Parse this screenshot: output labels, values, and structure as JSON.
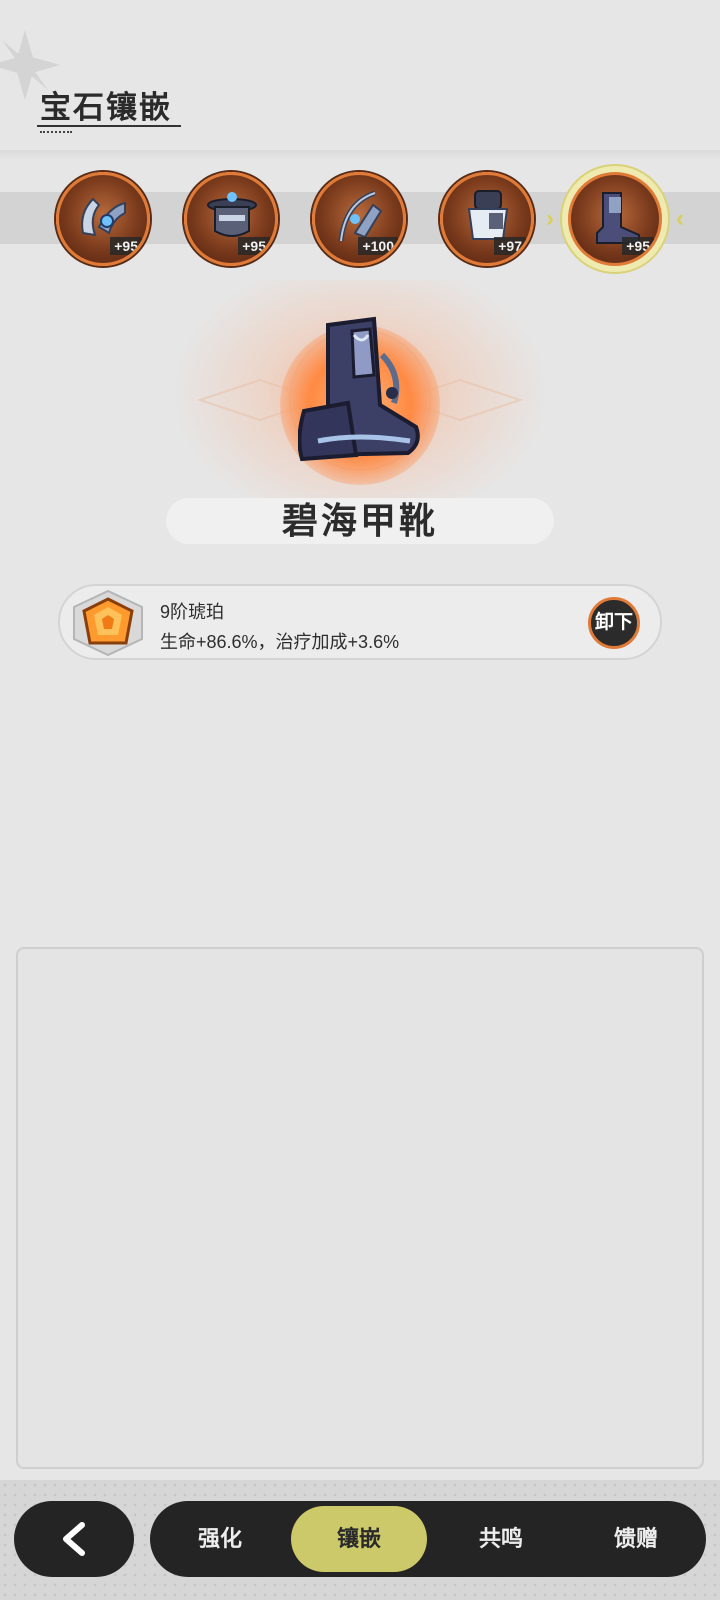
{
  "header": {
    "title": "宝石镶嵌"
  },
  "equipment": [
    {
      "name": "equip-slot-1",
      "level": "+95",
      "icon": "bracer-icon"
    },
    {
      "name": "equip-slot-2",
      "level": "+95",
      "icon": "helmet-icon"
    },
    {
      "name": "equip-slot-3",
      "level": "+100",
      "icon": "bow-icon"
    },
    {
      "name": "equip-slot-4",
      "level": "+97",
      "icon": "armor-icon"
    },
    {
      "name": "equip-slot-5",
      "level": "+95",
      "icon": "boots-icon",
      "selected": true
    }
  ],
  "selected_item": {
    "name": "碧海甲靴",
    "icon": "boots-icon"
  },
  "gem": {
    "name": "9阶琥珀",
    "stats": "生命+86.6%，治疗加成+3.6%",
    "action": "卸下",
    "icon": "amber-gem-icon"
  },
  "bottom_nav": {
    "back_icon": "back-arrow-icon",
    "tabs": [
      {
        "label": "强化"
      },
      {
        "label": "镶嵌",
        "active": true
      },
      {
        "label": "共鸣"
      },
      {
        "label": "馈赠"
      }
    ]
  },
  "colors": {
    "accent": "#ccc96a",
    "slot_border": "#e07a36",
    "bar": "#242424"
  }
}
